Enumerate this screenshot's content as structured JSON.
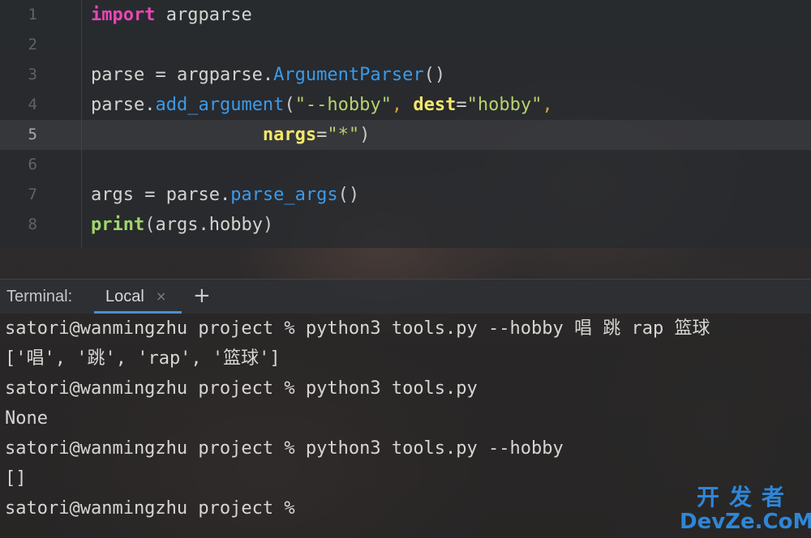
{
  "editor": {
    "lines": [
      {
        "num": "1",
        "tokens": [
          [
            "kw",
            "import"
          ],
          [
            "plain",
            " argparse"
          ]
        ]
      },
      {
        "num": "2",
        "tokens": []
      },
      {
        "num": "3",
        "tokens": [
          [
            "plain",
            "parse = argparse."
          ],
          [
            "fn",
            "ArgumentParser"
          ],
          [
            "paren",
            "()"
          ]
        ]
      },
      {
        "num": "4",
        "tokens": [
          [
            "plain",
            "parse."
          ],
          [
            "fn",
            "add_argument"
          ],
          [
            "paren",
            "("
          ],
          [
            "str",
            "\"--hobby\""
          ],
          [
            "comma",
            ", "
          ],
          [
            "kwarg",
            "dest"
          ],
          [
            "plain",
            "="
          ],
          [
            "str",
            "\"hobby\""
          ],
          [
            "comma",
            ","
          ]
        ]
      },
      {
        "num": "5",
        "tokens": [
          [
            "plain",
            "                "
          ],
          [
            "kwarg",
            "nargs"
          ],
          [
            "plain",
            "="
          ],
          [
            "str",
            "\"*\""
          ],
          [
            "paren",
            ")"
          ]
        ]
      },
      {
        "num": "6",
        "tokens": []
      },
      {
        "num": "7",
        "tokens": [
          [
            "plain",
            "args = parse."
          ],
          [
            "fn",
            "parse_args"
          ],
          [
            "paren",
            "()"
          ]
        ]
      },
      {
        "num": "8",
        "tokens": [
          [
            "builtin",
            "print"
          ],
          [
            "paren",
            "("
          ],
          [
            "plain",
            "args.hobby"
          ],
          [
            "paren",
            ")"
          ]
        ]
      }
    ],
    "current_line": "5"
  },
  "terminal": {
    "title": "Terminal:",
    "tab_label": "Local",
    "close_glyph": "×",
    "add_glyph": "+",
    "lines": [
      "satori@wanmingzhu project % python3 tools.py --hobby 唱 跳 rap 篮球",
      "['唱', '跳', 'rap', '篮球']",
      "satori@wanmingzhu project % python3 tools.py",
      "None",
      "satori@wanmingzhu project % python3 tools.py --hobby",
      "[]",
      "satori@wanmingzhu project %"
    ]
  },
  "watermark": {
    "top": "开发者",
    "bottom": "DevZe.CoM"
  },
  "colors": {
    "keyword": "#e847b6",
    "function": "#3b9ae9",
    "string": "#b6d26e",
    "kwarg": "#f3e86c",
    "builtin": "#9fd66b",
    "tab_underline": "#4b8fd9",
    "watermark": "#2f86d8"
  }
}
